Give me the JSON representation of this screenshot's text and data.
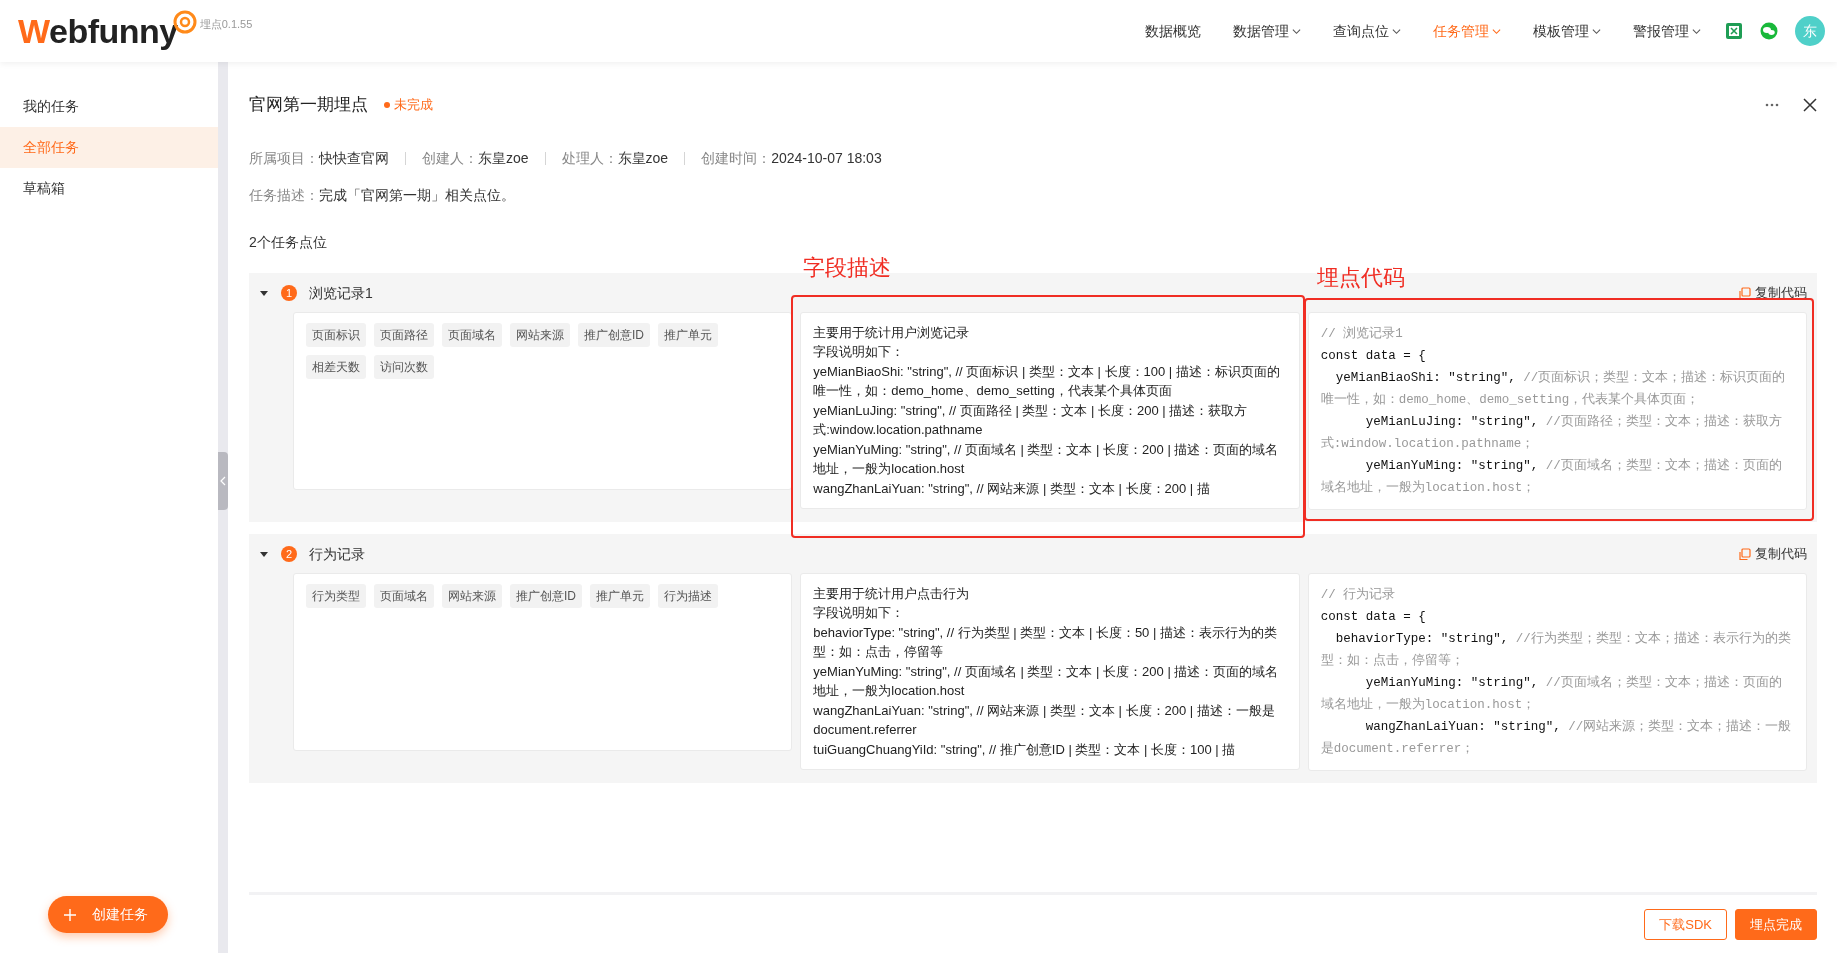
{
  "header": {
    "logo": "Webfunny",
    "version": "埋点0.1.55",
    "avatar": "东",
    "nav": [
      {
        "label": "数据概览",
        "dropdown": false,
        "selected": false
      },
      {
        "label": "数据管理",
        "dropdown": true,
        "selected": false
      },
      {
        "label": "查询点位",
        "dropdown": true,
        "selected": false
      },
      {
        "label": "任务管理",
        "dropdown": true,
        "selected": true
      },
      {
        "label": "模板管理",
        "dropdown": true,
        "selected": false
      },
      {
        "label": "警报管理",
        "dropdown": true,
        "selected": false
      }
    ]
  },
  "sidebar": {
    "items": [
      {
        "label": "我的任务",
        "selected": false
      },
      {
        "label": "全部任务",
        "selected": true
      },
      {
        "label": "草稿箱",
        "selected": false
      }
    ],
    "create_button": "创建任务"
  },
  "task": {
    "title": "官网第一期埋点",
    "status": {
      "label": "未完成",
      "kind": "incomplete"
    },
    "meta": [
      {
        "label": "所属项目：",
        "value": "快快查官网"
      },
      {
        "label": "创建人：",
        "value": "东皇zoe"
      },
      {
        "label": "处理人：",
        "value": "东皇zoe"
      },
      {
        "label": "创建时间：",
        "value": "2024-10-07 18:03"
      }
    ],
    "description": {
      "label": "任务描述：",
      "value": "完成「官网第一期」相关点位。"
    },
    "points_count": "2个任务点位"
  },
  "points": [
    {
      "number": "1",
      "name": "浏览记录1",
      "expanded": true,
      "copy_label": "复制代码",
      "tags": [
        "页面标识",
        "页面路径",
        "页面域名",
        "网站来源",
        "推广创意ID",
        "推广单元",
        "相差天数",
        "访问次数"
      ],
      "description": [
        "主要用于统计用户浏览记录",
        "字段说明如下：",
        "yeMianBiaoShi: \"string\", // 页面标识 | 类型：文本 | 长度：100 | 描述：标识页面的唯一性，如：demo_home、demo_setting，代表某个具体页面",
        "yeMianLuJing: \"string\", // 页面路径 | 类型：文本 | 长度：200 | 描述：获取方式:window.location.pathname",
        "yeMianYuMing: \"string\", // 页面域名 | 类型：文本 | 长度：200 | 描述：页面的域名地址，一般为location.host",
        "wangZhanLaiYuan: \"string\", // 网站来源 | 类型：文本 | 长度：200 | 描"
      ],
      "code": [
        {
          "comment": "// 浏览记录1"
        },
        {
          "code": "const data = {"
        },
        {
          "code": "  yeMianBiaoShi: \"string\", ",
          "comment": "//页面标识；类型：文本；描述：标识页面的唯一性，如：demo_home、demo_setting，代表某个具体页面；"
        },
        {
          "code": "      yeMianLuJing: \"string\", ",
          "comment": "//页面路径；类型：文本；描述：获取方式:window.location.pathname；"
        },
        {
          "code": "      yeMianYuMing: \"string\", ",
          "comment": "//页面域名；类型：文本；描述：页面的域名地址，一般为location.host；"
        }
      ],
      "annotations": [
        {
          "text": "字段描述",
          "kind": "description"
        },
        {
          "text": "埋点代码",
          "kind": "code"
        }
      ]
    },
    {
      "number": "2",
      "name": "行为记录",
      "expanded": true,
      "copy_label": "复制代码",
      "tags": [
        "行为类型",
        "页面域名",
        "网站来源",
        "推广创意ID",
        "推广单元",
        "行为描述"
      ],
      "description": [
        "主要用于统计用户点击行为",
        "字段说明如下：",
        "behaviorType: \"string\", // 行为类型 | 类型：文本 | 长度：50 | 描述：表示行为的类型：如：点击，停留等",
        "yeMianYuMing: \"string\", // 页面域名 | 类型：文本 | 长度：200 | 描述：页面的域名地址，一般为location.host",
        "wangZhanLaiYuan: \"string\", // 网站来源 | 类型：文本 | 长度：200 | 描述：一般是document.referrer",
        "tuiGuangChuangYiId: \"string\", // 推广创意ID | 类型：文本 | 长度：100 | 描"
      ],
      "code": [
        {
          "comment": "// 行为记录"
        },
        {
          "code": "const data = {"
        },
        {
          "code": "  behaviorType: \"string\", ",
          "comment": "//行为类型；类型：文本；描述：表示行为的类型：如：点击，停留等；"
        },
        {
          "code": "      yeMianYuMing: \"string\", ",
          "comment": "//页面域名；类型：文本；描述：页面的域名地址，一般为location.host；"
        },
        {
          "code": "      wangZhanLaiYuan: \"string\", ",
          "comment": "//网站来源；类型：文本；描述：一般是document.referrer；"
        }
      ]
    }
  ],
  "footer": {
    "buttons": [
      {
        "label": "下载SDK",
        "kind": "outline"
      },
      {
        "label": "埋点完成",
        "kind": "primary"
      }
    ]
  }
}
